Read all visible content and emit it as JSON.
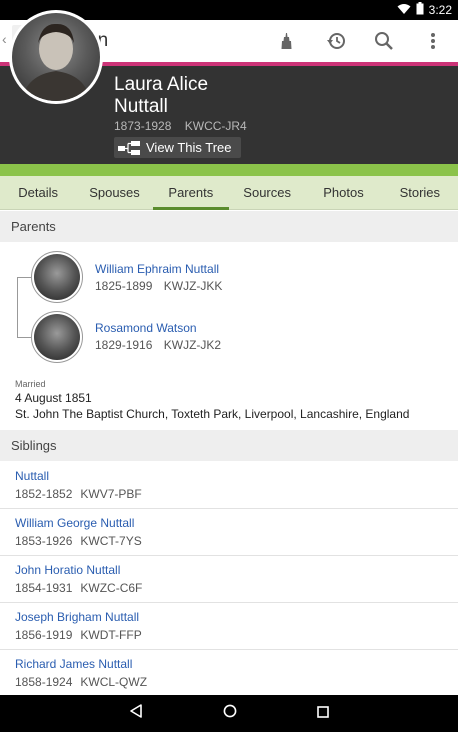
{
  "status_bar": {
    "time": "3:22"
  },
  "app_bar": {
    "title": "Person"
  },
  "person": {
    "first_names": "Laura Alice",
    "surname": "Nuttall",
    "lifespan": "1873-1928",
    "pid": "KWCC-JR4",
    "view_tree_label": "View This Tree"
  },
  "tabs": [
    {
      "label": "Details"
    },
    {
      "label": "Spouses"
    },
    {
      "label": "Parents"
    },
    {
      "label": "Sources"
    },
    {
      "label": "Photos"
    },
    {
      "label": "Stories"
    }
  ],
  "parents_section": {
    "header": "Parents",
    "father": {
      "name": "William Ephraim Nuttall",
      "lifespan": "1825-1899",
      "pid": "KWJZ-JKK"
    },
    "mother": {
      "name": "Rosamond Watson",
      "lifespan": "1829-1916",
      "pid": "KWJZ-JK2"
    },
    "marriage": {
      "label": "Married",
      "date": "4 August 1851",
      "place": "St. John The Baptist Church, Toxteth Park, Liverpool, Lancashire, England"
    }
  },
  "siblings_section": {
    "header": "Siblings",
    "items": [
      {
        "name": "Nuttall",
        "lifespan": "1852-1852",
        "pid": "KWV7-PBF"
      },
      {
        "name": "William George Nuttall",
        "lifespan": "1853-1926",
        "pid": "KWCT-7YS"
      },
      {
        "name": "John Horatio Nuttall",
        "lifespan": "1854-1931",
        "pid": "KWZC-C6F"
      },
      {
        "name": "Joseph Brigham Nuttall",
        "lifespan": "1856-1919",
        "pid": "KWDT-FFP"
      },
      {
        "name": "Richard James Nuttall",
        "lifespan": "1858-1924",
        "pid": "KWCL-QWZ"
      }
    ]
  },
  "colors": {
    "accent_pink": "#cc3377",
    "accent_green": "#8bc34a",
    "tab_bg": "#dfeacb",
    "link_blue": "#2a5db0",
    "header_dark": "#333333"
  },
  "icons": [
    "wifi-icon",
    "battery-icon",
    "back-chevron-icon",
    "family-tree-logo-icon",
    "temple-icon",
    "history-icon",
    "search-icon",
    "overflow-menu-icon",
    "tree-chart-icon",
    "nav-back-icon",
    "nav-home-icon",
    "nav-recents-icon"
  ]
}
